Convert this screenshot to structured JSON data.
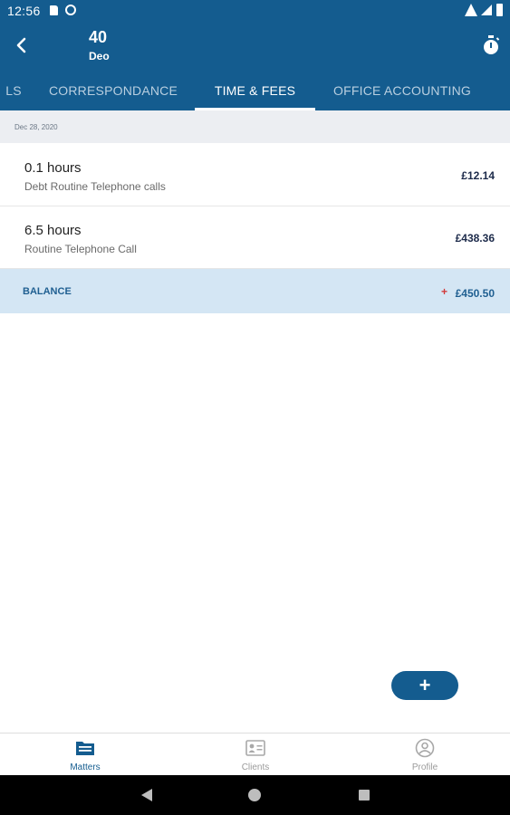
{
  "status_bar": {
    "time": "12:56"
  },
  "app_bar": {
    "matter_number": "40",
    "client_name": "Deo"
  },
  "tabs": [
    {
      "label": "LS",
      "active": false
    },
    {
      "label": "CORRESPONDANCE",
      "active": false
    },
    {
      "label": "TIME & FEES",
      "active": true
    },
    {
      "label": "OFFICE ACCOUNTING",
      "active": false
    }
  ],
  "date_header": "Dec 28, 2020",
  "entries": [
    {
      "hours": "0.1 hours",
      "description": "Debt Routine Telephone calls",
      "amount": "£12.14"
    },
    {
      "hours": "6.5 hours",
      "description": "Routine Telephone Call",
      "amount": "£438.36"
    }
  ],
  "balance": {
    "label": "BALANCE",
    "sign": "+",
    "amount": "£450.50"
  },
  "fab": {
    "label": "+"
  },
  "bottom_nav": [
    {
      "label": "Matters",
      "icon": "folder-icon",
      "active": true
    },
    {
      "label": "Clients",
      "icon": "contact-card-icon",
      "active": false
    },
    {
      "label": "Profile",
      "icon": "person-circle-icon",
      "active": false
    }
  ],
  "colors": {
    "primary": "#145c8f",
    "balance_background": "#d4e6f4",
    "balance_plus": "#d23b3b"
  }
}
